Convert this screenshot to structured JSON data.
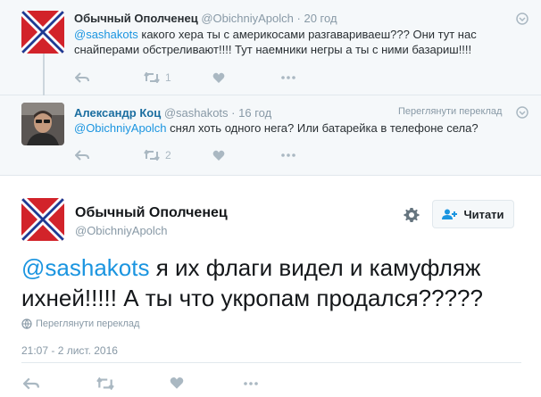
{
  "tweet1": {
    "name": "Обычный Ополченец",
    "handle": "@ObichniyApolch",
    "dot": "·",
    "time": "20 год",
    "mention": "@sashakots",
    "text": " какого хера ты с америкосами разгавариваеш??? Они тут нас снайперами обстреливают!!!! Тут наемники негры а ты с ними базариш!!!!",
    "retweets": "1",
    "likes": ""
  },
  "tweet2": {
    "name": "Александр Коц",
    "handle": "@sashakots",
    "dot": "·",
    "time": "16 год",
    "translate": "Переглянути переклад",
    "mention": "@ObichniyApolch",
    "text": " снял хоть одного нега? Или батарейка в телефоне села?",
    "retweets": "2",
    "likes": ""
  },
  "tweet3": {
    "name": "Обычный Ополченец",
    "handle": "@ObichniyApolch",
    "follow_label": "Читати",
    "mention": "@sashakots",
    "text": " я их флаги видел и камуфляж ихней!!!!! А ты что укропам продался?????",
    "translate": "Переглянути переклад",
    "timestamp": "21:07 - 2 лист. 2016"
  },
  "colors": {
    "link": "#1b95e0",
    "name_link": "#1b6ea0",
    "muted": "#8899a6",
    "icon": "#aab8c2",
    "flag_red": "#d2232a",
    "flag_blue": "#1f3a93"
  }
}
